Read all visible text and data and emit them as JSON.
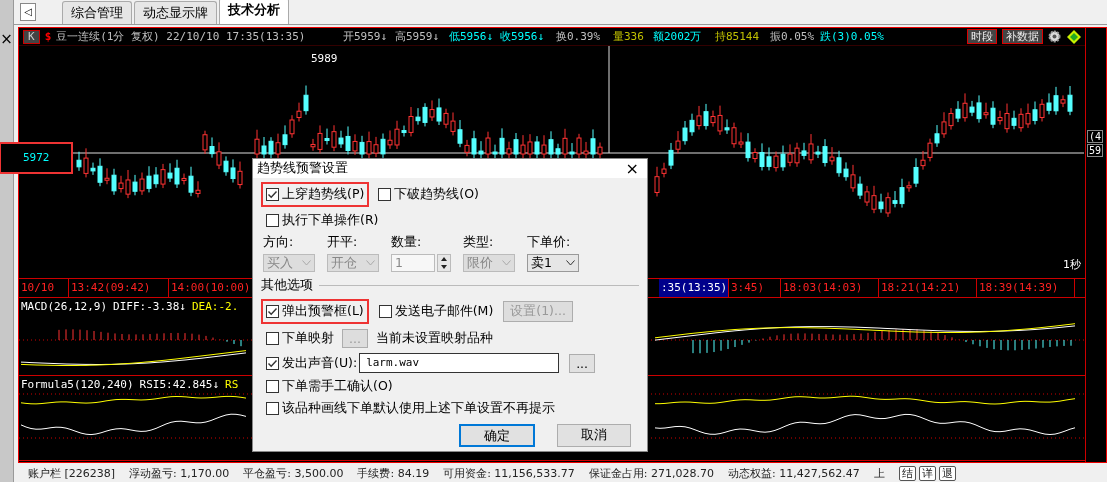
{
  "side_strip": {
    "close": "×"
  },
  "tabs": {
    "back": "◁",
    "items": [
      {
        "label": "综合管理",
        "selected": false
      },
      {
        "label": "动态显示牌",
        "selected": false
      },
      {
        "label": "技术分析",
        "selected": true
      }
    ]
  },
  "chart": {
    "period_button": "K",
    "symbol_mark": "$",
    "title": "豆一连续(1分 复权) 22/10/10 17:35(13:35)",
    "header": [
      {
        "text": "开5959↓",
        "color": "#c0c0c0"
      },
      {
        "text": "高5959↓",
        "color": "#c0c0c0"
      },
      {
        "text": "低5956↓",
        "color": "#00ffff"
      },
      {
        "text": "收5956↓",
        "color": "#00ffff"
      },
      {
        "text": "换0.39%",
        "color": "#c0c0c0"
      },
      {
        "text": "量336",
        "color": "#c0c000"
      },
      {
        "text": "额2002万",
        "color": "#00ffff"
      },
      {
        "text": "持85144",
        "color": "#c0c000"
      },
      {
        "text": "振0.05%",
        "color": "#c0c0c0"
      },
      {
        "text": "跌(3)0.05%",
        "color": "#00ffff"
      }
    ],
    "header_buttons": [
      "时段",
      "补数据"
    ],
    "peak_label": "5989",
    "cursor_price": "5972",
    "cursor_highlighted": true,
    "period": "1秒",
    "axis_labels": [
      "(4",
      "59"
    ],
    "time_axis": [
      {
        "label": "10/10",
        "selected": false
      },
      {
        "label": "13:42(09:42)",
        "selected": false
      },
      {
        "label": "14:00(10:00)",
        "selected": false
      },
      {
        "label": ":35(13:35)",
        "selected": true
      },
      {
        "label": "3:45)",
        "selected": false
      },
      {
        "label": "18:03(14:03)",
        "selected": false
      },
      {
        "label": "18:21(14:21)",
        "selected": false
      },
      {
        "label": "18:39(14:39)",
        "selected": false
      }
    ]
  },
  "macd": {
    "title": "MACD(26,12,9)",
    "items": [
      {
        "text": "DIFF:-3.38↓",
        "color": "#ffffff"
      },
      {
        "text": "DEA:-2.",
        "color": "#ffff00"
      }
    ]
  },
  "rsi": {
    "title": "Formula5(120,240)",
    "items": [
      {
        "text": "RSI5:42.845↓",
        "color": "#ffffff"
      },
      {
        "text": "RS",
        "color": "#ffff00"
      }
    ]
  },
  "dialog": {
    "title": "趋势线预警设置",
    "close": "×",
    "cross_options": [
      {
        "label": "上穿趋势线(P)",
        "checked": true,
        "highlighted": true
      },
      {
        "label": "下破趋势线(O)",
        "checked": false,
        "highlighted": false
      }
    ],
    "execute_order": {
      "label": "执行下单操作(R)",
      "checked": false
    },
    "order_fields": [
      {
        "label": "方向:",
        "value": "买入",
        "kind": "select",
        "disabled": true
      },
      {
        "label": "开平:",
        "value": "开仓",
        "kind": "select",
        "disabled": true
      },
      {
        "label": "数量:",
        "value": "1",
        "kind": "spin",
        "disabled": true
      },
      {
        "label": "类型:",
        "value": "限价",
        "kind": "select",
        "disabled": true
      },
      {
        "label": "下单价:",
        "value": "卖1",
        "kind": "select",
        "disabled": false
      }
    ],
    "section_title": "其他选项",
    "popup": {
      "label": "弹出预警框(L)",
      "checked": true,
      "highlighted": true
    },
    "email": {
      "label": "发送电子邮件(M)",
      "checked": false,
      "button": "设置(1)...",
      "button_disabled": true
    },
    "mapping": {
      "label": "下单映射",
      "checked": false,
      "button": "...",
      "button_disabled": true,
      "note": "当前未设置映射品种"
    },
    "sound": {
      "label": "发出声音(U):",
      "checked": true,
      "file": "larm.wav",
      "button": "..."
    },
    "manual_confirm": {
      "label": "下单需手工确认(O)",
      "checked": false
    },
    "no_prompt": {
      "label": "该品种画线下单默认使用上述下单设置不再提示",
      "checked": false
    },
    "buttons": [
      {
        "label": "确定",
        "default": true
      },
      {
        "label": "取消",
        "default": false
      }
    ]
  },
  "status_bar": {
    "items": [
      "账户栏 [226238]",
      "浮动盈亏: 1,170.00",
      "平仓盈亏: 3,500.00",
      "手续费: 84.19",
      "可用资金: 11,156,533.77",
      "保证金占用: 271,028.70",
      "动态权益: 11,427,562.47",
      "上"
    ],
    "buttons": [
      "结",
      "详",
      "退"
    ]
  }
}
